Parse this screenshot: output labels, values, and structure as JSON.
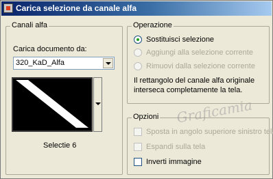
{
  "window": {
    "title": "Carica selezione da canale alfa"
  },
  "left_group": {
    "legend": "Canali alfa",
    "doc_label": "Carica documento da:",
    "doc_select_value": "320_KaD_Alfa",
    "preview_caption": "Selectie 6"
  },
  "operazione": {
    "legend": "Operazione",
    "options": [
      {
        "label": "Sostituisci selezione",
        "selected": true,
        "enabled": true
      },
      {
        "label": "Aggiungi alla selezione corrente",
        "selected": false,
        "enabled": false
      },
      {
        "label": "Rimuovi dalla selezione corrente",
        "selected": false,
        "enabled": false
      }
    ],
    "info_line1": "Il rettangolo del canale alfa originale",
    "info_line2": "interseca completamente la tela."
  },
  "opzioni": {
    "legend": "Opzioni",
    "options": [
      {
        "label": "Sposta in angolo superiore sinistro tela",
        "checked": false,
        "enabled": false
      },
      {
        "label": "Espandi sulla tela",
        "checked": false,
        "enabled": false
      },
      {
        "label": "Inverti immagine",
        "checked": false,
        "enabled": true
      }
    ]
  },
  "watermark": "Graficamia"
}
